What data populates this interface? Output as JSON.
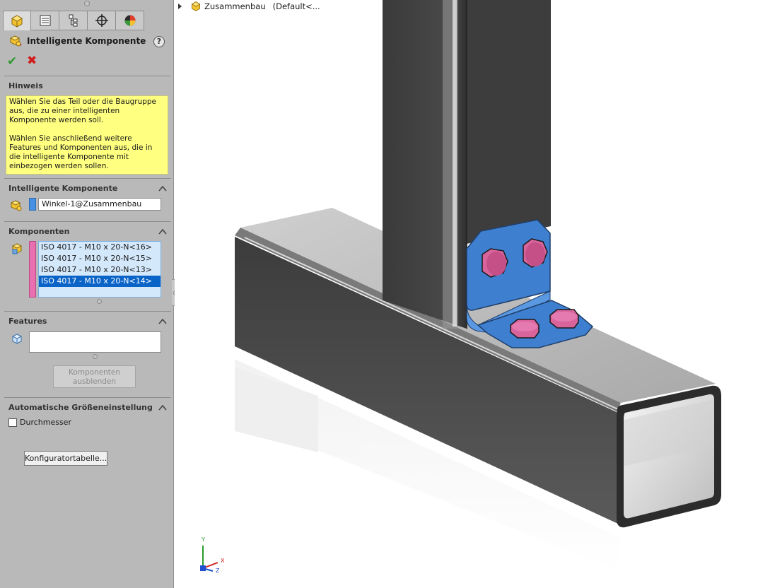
{
  "property_manager": {
    "title": "Intelligente Komponente",
    "help_symbol": "?",
    "ok_symbol": "✔",
    "cancel_symbol": "✖",
    "tabs": [
      "feature-manager",
      "property-manager",
      "configuration-manager",
      "dim-xpert",
      "display-manager"
    ],
    "hint": {
      "header": "Hinweis",
      "paragraph1": "Wählen Sie das Teil oder die Baugruppe aus, die zu einer intelligenten Komponente werden soll.",
      "paragraph2": "Wählen Sie anschließend weitere Features und Komponenten aus, die in die intelligente Komponente mit einbezogen werden sollen."
    },
    "smart_component": {
      "header": "Intelligente Komponente",
      "value": "Winkel-1@Zusammenbau",
      "color": "#4a90e2"
    },
    "components": {
      "header": "Komponenten",
      "color": "#e86fb0",
      "items": [
        "ISO 4017 - M10 x 20-N<16>",
        "ISO 4017 - M10 x 20-N<15>",
        "ISO 4017 - M10 x 20-N<13>",
        "ISO 4017 - M10 x 20-N<14>"
      ],
      "selected_index": 3
    },
    "features": {
      "header": "Features",
      "value": "",
      "hide_components_label_line1": "Komponenten",
      "hide_components_label_line2": "ausblenden"
    },
    "auto_size": {
      "header": "Automatische Größeneinstellung",
      "checkbox_label": "Durchmesser",
      "checked": false
    },
    "configurator_button": "Konfiguratortabelle..."
  },
  "graphics": {
    "tree_root": "Zusammenbau",
    "tree_config": "(Default<...",
    "axis_labels": {
      "x": "X",
      "y": "Y",
      "z": "Z"
    },
    "colors": {
      "bracket": "#3f7fd0",
      "bolts": "#d9649c",
      "tube": "#4a4a4a",
      "background": "#ffffff"
    }
  }
}
